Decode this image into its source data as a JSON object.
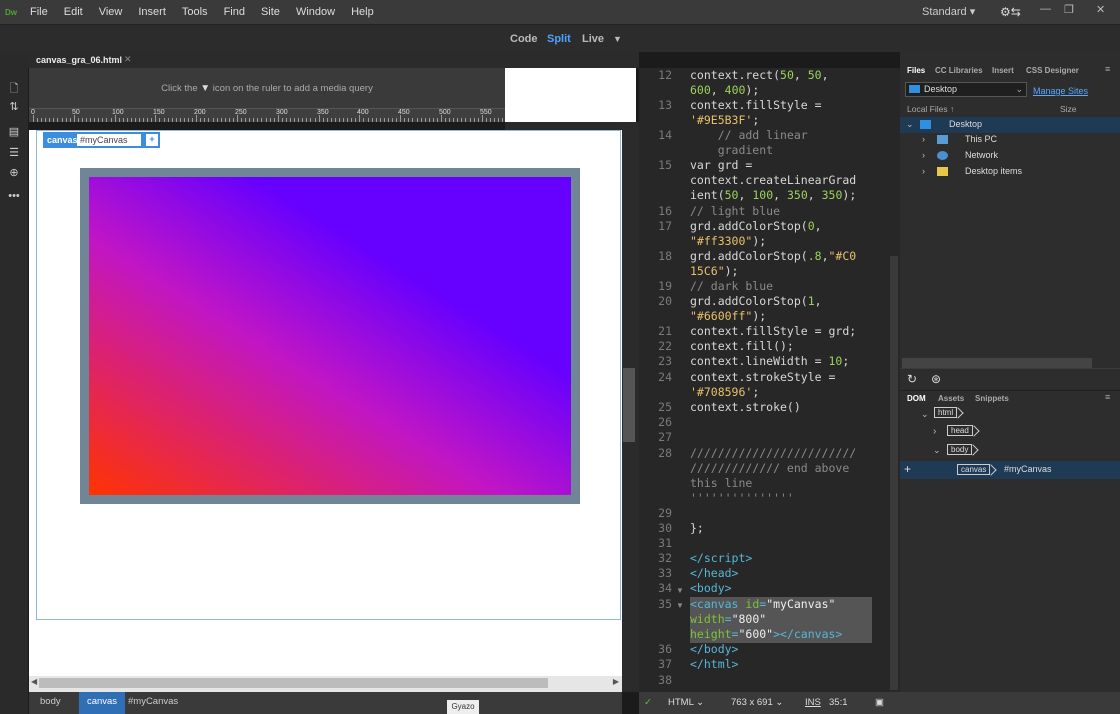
{
  "app": {
    "logo": "Dw",
    "menus": [
      "File",
      "Edit",
      "View",
      "Insert",
      "Tools",
      "Find",
      "Site",
      "Window",
      "Help"
    ],
    "workspace": "Standard"
  },
  "viewbar": {
    "code": "Code",
    "split": "Split",
    "live": "Live"
  },
  "document": {
    "tab": "canvas_gra_06.html"
  },
  "mediaquery": {
    "text_before": "Click the",
    "text_after": "icon on the ruler to add a media query"
  },
  "ruler": {
    "labels": [
      "0",
      "50",
      "100",
      "150",
      "200",
      "250",
      "300",
      "350",
      "400",
      "450",
      "500",
      "550"
    ]
  },
  "element": {
    "tag": "canvas",
    "id": "#myCanvas",
    "plus": "+"
  },
  "code": {
    "line_numbers": [
      "12",
      "13",
      "14",
      "15",
      "16",
      "17",
      "18",
      "19",
      "20",
      "21",
      "22",
      "23",
      "24",
      "25",
      "26",
      "27",
      "28",
      "29",
      "30",
      "31",
      "32",
      "33",
      "34",
      "35",
      "36",
      "37",
      "38"
    ]
  },
  "files_panel": {
    "tabs": [
      "Files",
      "CC Libraries",
      "Insert",
      "CSS Designer"
    ],
    "site": "Desktop",
    "manage": "Manage Sites",
    "col_local": "Local Files",
    "col_size": "Size",
    "items": [
      "Desktop",
      "This PC",
      "Network",
      "Desktop items"
    ]
  },
  "dom_panel": {
    "tabs": [
      "DOM",
      "Assets",
      "Snippets"
    ],
    "nodes": [
      "html",
      "head",
      "body",
      "canvas"
    ],
    "selected_id": "#myCanvas"
  },
  "statusbar": {
    "crumbs": [
      "body",
      "canvas",
      "#myCanvas"
    ],
    "gyazo": "Gyazo",
    "doctype": "HTML",
    "size": "763 x 691",
    "ins": "INS",
    "pos": "35:1"
  },
  "colors": {
    "gradient_start": "#ff3300",
    "gradient_mid": "#C015C6",
    "gradient_end": "#6600ff",
    "stroke": "#708596",
    "accent": "#3d8dde"
  }
}
